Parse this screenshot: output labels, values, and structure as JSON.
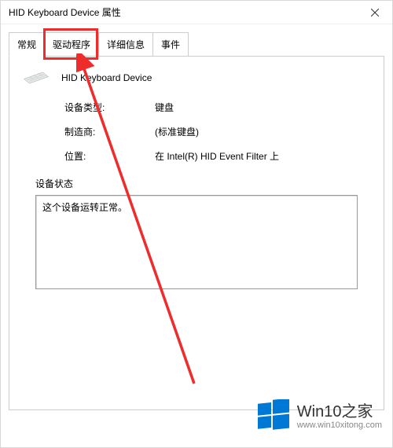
{
  "window": {
    "title": "HID Keyboard Device 属性"
  },
  "tabs": {
    "general": "常规",
    "driver": "驱动程序",
    "details": "详细信息",
    "events": "事件"
  },
  "device": {
    "name": "HID Keyboard Device"
  },
  "props": {
    "type_label": "设备类型:",
    "type_value": "键盘",
    "maker_label": "制造商:",
    "maker_value": "(标准键盘)",
    "location_label": "位置:",
    "location_value": "在 Intel(R) HID Event Filter 上"
  },
  "status": {
    "label": "设备状态",
    "value": "这个设备运转正常。"
  },
  "watermark": {
    "brand": "Win10之家",
    "url": "www.win10xitong.com"
  }
}
